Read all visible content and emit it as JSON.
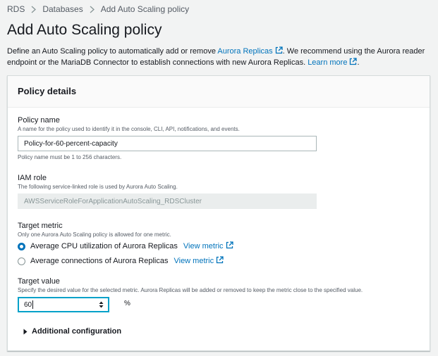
{
  "breadcrumb": {
    "items": [
      "RDS",
      "Databases",
      "Add Auto Scaling policy"
    ]
  },
  "page": {
    "title": "Add Auto Scaling policy",
    "desc_part1": "Define an Auto Scaling policy to automatically add or remove ",
    "desc_link1": "Aurora Replicas",
    "desc_part2": ". We recommend using the Aurora reader endpoint or the MariaDB Connector to establish connections with new Aurora Replicas. ",
    "desc_link2": "Learn more"
  },
  "panel": {
    "title": "Policy details",
    "policy_name": {
      "label": "Policy name",
      "hint": "A name for the policy used to identify it in the console, CLI, API, notifications, and events.",
      "value": "Policy-for-60-percent-capacity",
      "constraint": "Policy name must be 1 to 256 characters."
    },
    "iam_role": {
      "label": "IAM role",
      "hint": "The following service-linked role is used by Aurora Auto Scaling.",
      "value": "AWSServiceRoleForApplicationAutoScaling_RDSCluster"
    },
    "target_metric": {
      "label": "Target metric",
      "hint": "Only one Aurora Auto Scaling policy is allowed for one metric.",
      "options": [
        {
          "label": "Average CPU utilization of Aurora Replicas",
          "link": "View metric",
          "selected": true
        },
        {
          "label": "Average connections of Aurora Replicas",
          "link": "View metric",
          "selected": false
        }
      ]
    },
    "target_value": {
      "label": "Target value",
      "hint": "Specify the desired value for the selected metric. Aurora Replicas will be added or removed to keep the metric close to the specified value.",
      "value": "60",
      "unit": "%"
    },
    "additional": {
      "label": "Additional configuration"
    }
  },
  "colors": {
    "link": "#0073bb",
    "focus": "#00a1c9",
    "background": "#f2f3f3"
  },
  "icons": [
    "chevron-right-icon",
    "external-link-icon",
    "caret-right-icon",
    "stepper-arrows-icon"
  ]
}
